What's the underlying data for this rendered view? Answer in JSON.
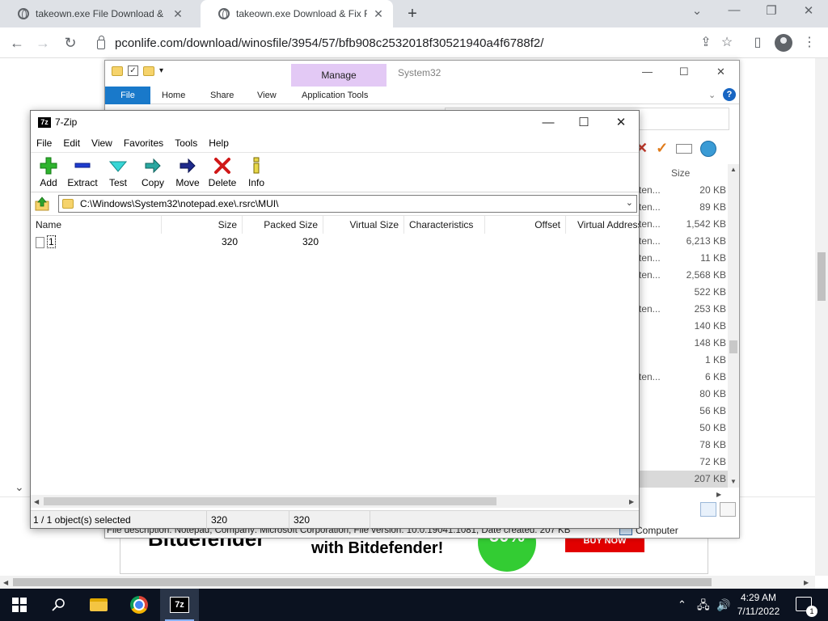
{
  "browser": {
    "tabs": [
      {
        "title": "takeown.exe File Download & Fix",
        "close": "✕"
      },
      {
        "title": "takeown.exe Download & Fix For",
        "close": "✕"
      }
    ],
    "new_tab": "+",
    "url": "pconlife.com/download/winosfile/3954/57/bfb908c2532018f30521940a4f6788f2/"
  },
  "ad": {
    "brand": "Bitdefender",
    "tagline": "with Bitdefender!",
    "badge": "50%",
    "button": "BUY NOW"
  },
  "explorer": {
    "manage": "Manage",
    "title": "System32",
    "tabs": [
      "File",
      "Home",
      "Share",
      "View",
      "Application Tools"
    ],
    "size_header": "Size",
    "rows": [
      {
        "t": "ten...",
        "s": "20 KB"
      },
      {
        "t": "ten...",
        "s": "89 KB"
      },
      {
        "t": "ten...",
        "s": "1,542 KB"
      },
      {
        "t": "ten...",
        "s": "6,213 KB"
      },
      {
        "t": "ten...",
        "s": "11 KB"
      },
      {
        "t": "ten...",
        "s": "2,568 KB"
      },
      {
        "t": "",
        "s": "522 KB"
      },
      {
        "t": "ten...",
        "s": "253 KB"
      },
      {
        "t": "",
        "s": "140 KB"
      },
      {
        "t": "",
        "s": "148 KB"
      },
      {
        "t": "",
        "s": "1 KB"
      },
      {
        "t": "ten...",
        "s": "6 KB"
      },
      {
        "t": "",
        "s": "80 KB"
      },
      {
        "t": "",
        "s": "56 KB"
      },
      {
        "t": "",
        "s": "50 KB"
      },
      {
        "t": "",
        "s": "78 KB"
      },
      {
        "t": "",
        "s": "72 KB"
      },
      {
        "t": "",
        "s": "207 KB"
      }
    ],
    "details": "File description: Notepad, Company: Microsoft Corporation, File version: 10.0.19041.1081, Date created: 207 KB",
    "computer": "Computer"
  },
  "zip": {
    "title": "7-Zip",
    "logo": "7z",
    "menu": [
      "File",
      "Edit",
      "View",
      "Favorites",
      "Tools",
      "Help"
    ],
    "toolbar": {
      "add": "Add",
      "extract": "Extract",
      "test": "Test",
      "copy": "Copy",
      "move": "Move",
      "delete": "Delete",
      "info": "Info"
    },
    "path": "C:\\Windows\\System32\\notepad.exe\\.rsrc\\MUI\\",
    "columns": {
      "name": "Name",
      "size": "Size",
      "packed": "Packed Size",
      "virtual": "Virtual Size",
      "chars": "Characteristics",
      "offset": "Offset",
      "vaddr": "Virtual Address"
    },
    "rows": [
      {
        "name": "1",
        "size": "320",
        "packed": "320"
      }
    ],
    "status": {
      "selected": "1 / 1 object(s) selected",
      "size": "320",
      "packed": "320"
    }
  },
  "taskbar": {
    "seven_zip": "7z",
    "time": "4:29 AM",
    "date": "7/11/2022",
    "notifications": "1"
  }
}
